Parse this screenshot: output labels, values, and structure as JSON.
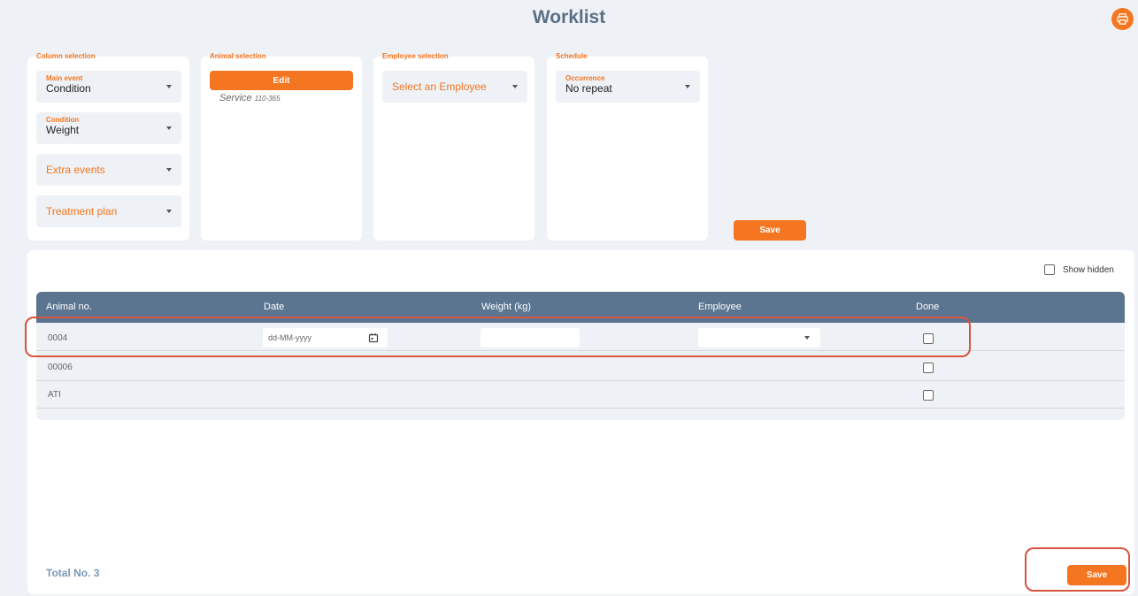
{
  "page": {
    "title": "Worklist"
  },
  "colors": {
    "accent": "#f47621",
    "header": "#5b7490",
    "highlight": "#d9533d"
  },
  "column_selection": {
    "label": "Column selection",
    "main_event": {
      "label": "Main event",
      "value": "Condition"
    },
    "condition": {
      "label": "Condition",
      "value": "Weight"
    },
    "extra_events": {
      "placeholder": "Extra events"
    },
    "treatment_plan": {
      "placeholder": "Treatment plan"
    }
  },
  "animal_selection": {
    "label": "Animal selection",
    "edit_label": "Edit",
    "service": "Service",
    "service_range": "110-365"
  },
  "employee_selection": {
    "label": "Employee selection",
    "placeholder": "Select an Employee"
  },
  "schedule": {
    "label": "Schedule",
    "occurrence": {
      "label": "Occurrence",
      "value": "No repeat"
    }
  },
  "top_save_label": "Save",
  "show_hidden_label": "Show hidden",
  "table": {
    "columns": [
      "Animal no.",
      "Date",
      "Weight (kg)",
      "Employee",
      "Done"
    ],
    "date_placeholder": "dd-MM-yyyy",
    "rows": [
      {
        "animal_no": "0004"
      },
      {
        "animal_no": "00006"
      },
      {
        "animal_no": "ATI"
      }
    ]
  },
  "total_label": "Total No. 3",
  "bottom_save_label": "Save"
}
